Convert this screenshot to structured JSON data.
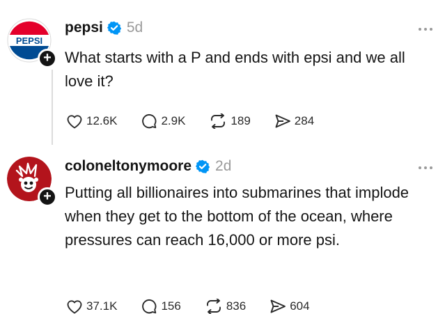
{
  "posts": [
    {
      "username": "pepsi",
      "age": "5d",
      "logo_text": "PEPSI",
      "text": "What starts with a P and ends with epsi and we all love it?",
      "actions": {
        "likes": "12.6K",
        "replies": "2.9K",
        "reposts": "189",
        "shares": "284"
      }
    },
    {
      "username": "coloneltonymoore",
      "age": "2d",
      "text": "Putting all billionaires into submarines that implode when they get to the bottom of the ocean, where pressures can reach 16,000 or more psi.",
      "actions": {
        "likes": "37.1K",
        "replies": "156",
        "reposts": "836",
        "shares": "604"
      }
    }
  ],
  "colors": {
    "pepsi_red": "#e4002b",
    "pepsi_blue": "#004b93",
    "verified": "#0095f6",
    "avatar_red": "#b3141c",
    "muted": "#9a9a9a"
  },
  "icons": [
    "heart-icon",
    "comment-icon",
    "repost-icon",
    "share-icon",
    "verified-icon",
    "more-icon",
    "follow-plus-icon"
  ]
}
